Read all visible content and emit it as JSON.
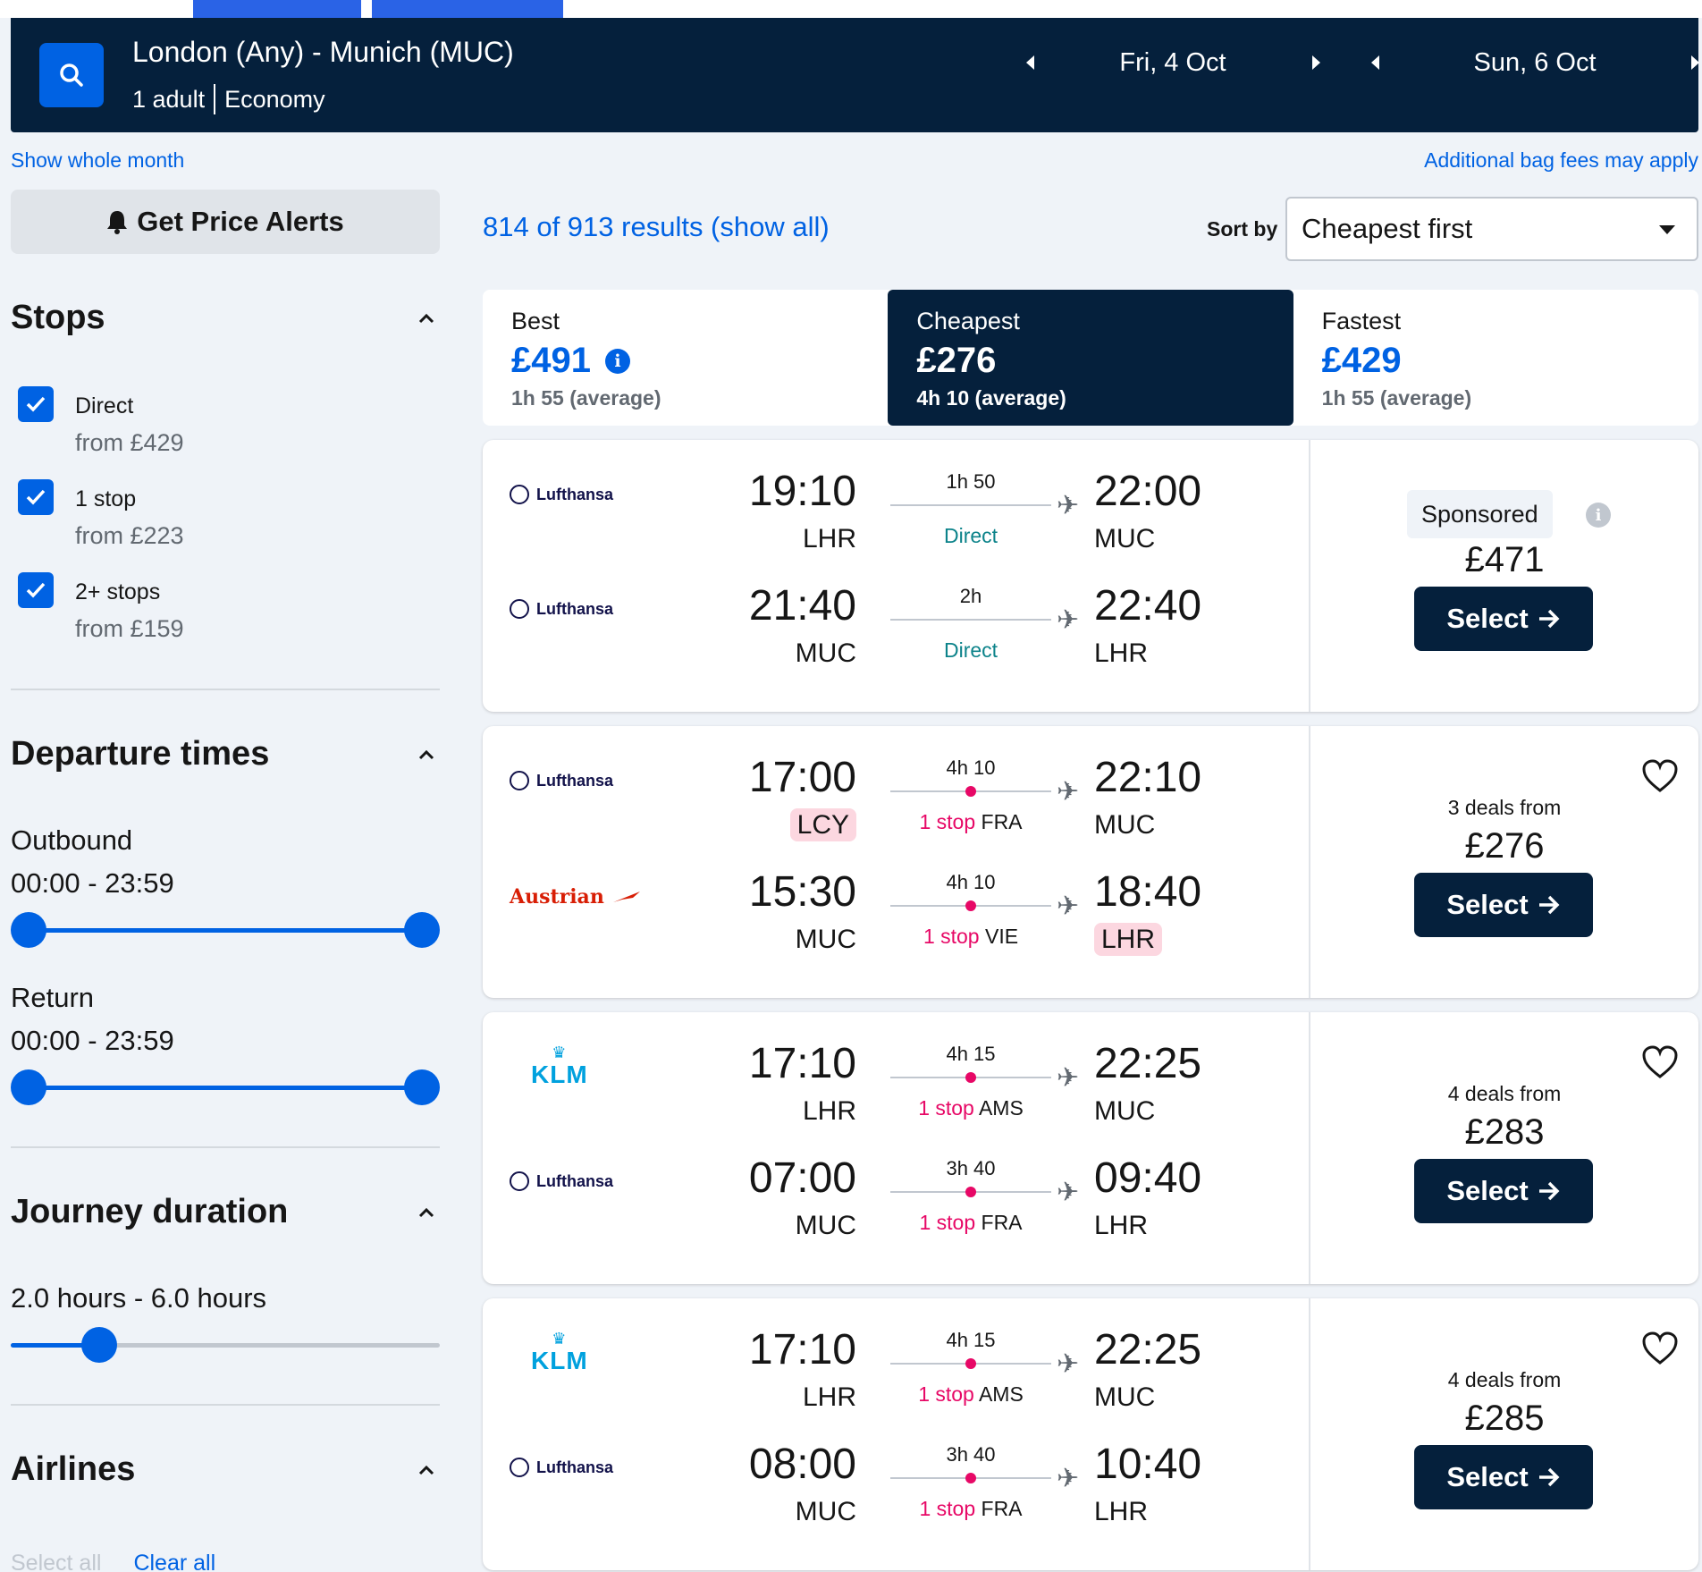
{
  "header": {
    "route": "London (Any) - Munich (MUC)",
    "passengers": "1 adult",
    "cabin": "Economy",
    "depart_date": "Fri, 4 Oct",
    "return_date": "Sun, 6 Oct"
  },
  "links": {
    "whole_month": "Show whole month",
    "bag_fees": "Additional bag fees may apply"
  },
  "sidebar": {
    "alerts_label": "Get Price Alerts",
    "stops": {
      "title": "Stops",
      "items": [
        {
          "label": "Direct",
          "from": "from £429",
          "checked": true
        },
        {
          "label": "1 stop",
          "from": "from £223",
          "checked": true
        },
        {
          "label": "2+ stops",
          "from": "from £159",
          "checked": true
        }
      ]
    },
    "departure_times": {
      "title": "Departure times",
      "outbound_label": "Outbound",
      "outbound_range": "00:00 - 23:59",
      "return_label": "Return",
      "return_range": "00:00 - 23:59"
    },
    "journey_duration": {
      "title": "Journey duration",
      "range": "2.0 hours - 6.0 hours",
      "slider_fraction": 0.18
    },
    "airlines": {
      "title": "Airlines",
      "select_all": "Select all",
      "clear_all": "Clear all"
    }
  },
  "results": {
    "count_text": "814 of 913 results (show all)",
    "sort_label": "Sort by",
    "sort_value": "Cheapest first"
  },
  "sort_tabs": [
    {
      "name": "Best",
      "price": "£491",
      "avg": "1h 55 (average)"
    },
    {
      "name": "Cheapest",
      "price": "£276",
      "avg": "4h 10 (average)"
    },
    {
      "name": "Fastest",
      "price": "£429",
      "avg": "1h 55 (average)"
    }
  ],
  "cards": [
    {
      "legs": [
        {
          "airline": "Lufthansa",
          "dep_time": "19:10",
          "dep_ap": "LHR",
          "duration": "1h 50",
          "stops_label": "Direct",
          "stop_via": "",
          "arr_time": "22:00",
          "arr_ap": "MUC"
        },
        {
          "airline": "Lufthansa",
          "dep_time": "21:40",
          "dep_ap": "MUC",
          "duration": "2h",
          "stops_label": "Direct",
          "stop_via": "",
          "arr_time": "22:40",
          "arr_ap": "LHR"
        }
      ],
      "sponsored": "Sponsored",
      "price": "£471",
      "select": "Select"
    },
    {
      "legs": [
        {
          "airline": "Lufthansa",
          "dep_time": "17:00",
          "dep_ap": "LCY",
          "duration": "4h 10",
          "stops_label": "1 stop",
          "stop_via": "FRA",
          "arr_time": "22:10",
          "arr_ap": "MUC"
        },
        {
          "airline": "Austrian",
          "dep_time": "15:30",
          "dep_ap": "MUC",
          "duration": "4h 10",
          "stops_label": "1 stop",
          "stop_via": "VIE",
          "arr_time": "18:40",
          "arr_ap": "LHR"
        }
      ],
      "deals": "3 deals from",
      "price": "£276",
      "select": "Select"
    },
    {
      "legs": [
        {
          "airline": "KLM",
          "dep_time": "17:10",
          "dep_ap": "LHR",
          "duration": "4h 15",
          "stops_label": "1 stop",
          "stop_via": "AMS",
          "arr_time": "22:25",
          "arr_ap": "MUC"
        },
        {
          "airline": "Lufthansa",
          "dep_time": "07:00",
          "dep_ap": "MUC",
          "duration": "3h 40",
          "stops_label": "1 stop",
          "stop_via": "FRA",
          "arr_time": "09:40",
          "arr_ap": "LHR"
        }
      ],
      "deals": "4 deals from",
      "price": "£283",
      "select": "Select"
    },
    {
      "legs": [
        {
          "airline": "KLM",
          "dep_time": "17:10",
          "dep_ap": "LHR",
          "duration": "4h 15",
          "stops_label": "1 stop",
          "stop_via": "AMS",
          "arr_time": "22:25",
          "arr_ap": "MUC"
        },
        {
          "airline": "Lufthansa",
          "dep_time": "08:00",
          "dep_ap": "MUC",
          "duration": "3h 40",
          "stops_label": "1 stop",
          "stop_via": "FRA",
          "arr_time": "10:40",
          "arr_ap": "LHR"
        }
      ],
      "deals": "4 deals from",
      "price": "£285",
      "select": "Select"
    }
  ],
  "colors": {
    "navy": "#05203c",
    "accent_blue": "#0062e3",
    "stop_red": "#e70866",
    "direct_teal": "#0c838a",
    "airport_highlight": "#fcd7e0"
  },
  "icons": [
    "search-icon",
    "bell-icon",
    "chevron-up-icon",
    "checkmark-icon",
    "info-icon",
    "plane-icon",
    "heart-icon",
    "arrow-right-icon",
    "caret-down-icon",
    "caret-left-icon",
    "caret-right-icon"
  ]
}
